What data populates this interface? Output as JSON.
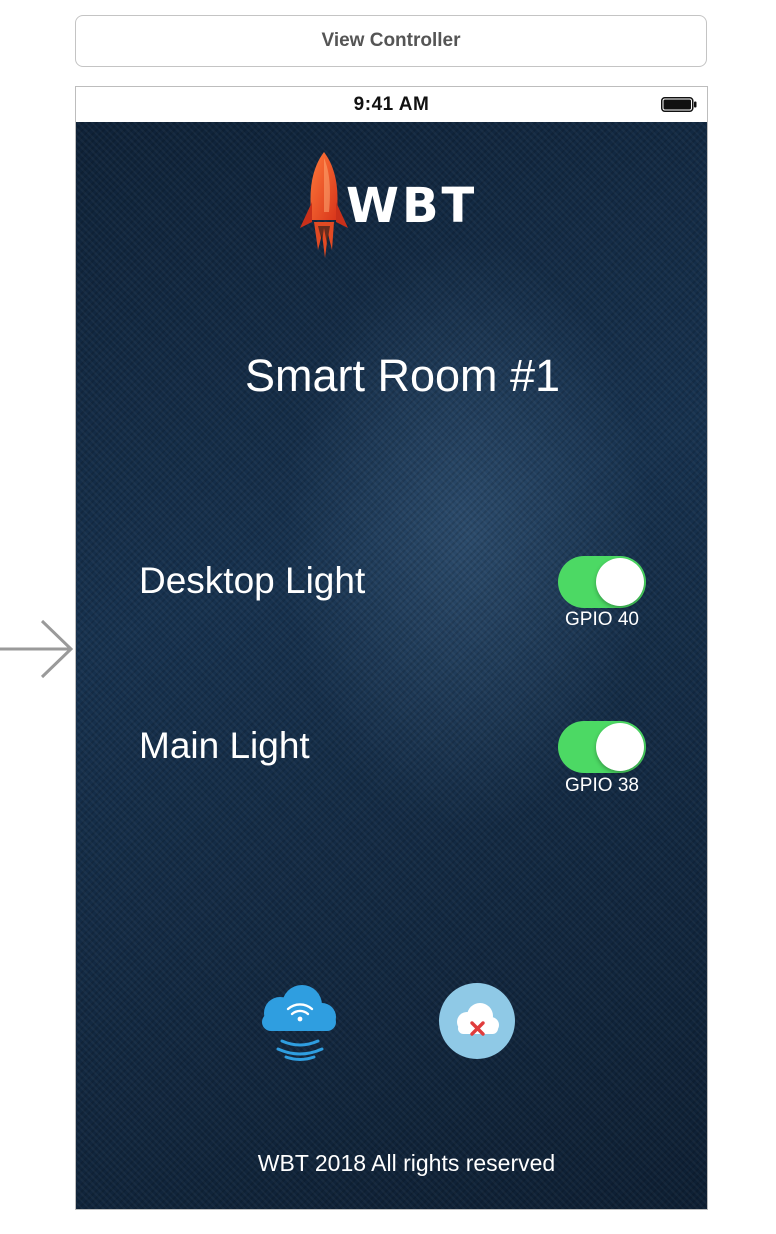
{
  "storyboard": {
    "scene_title": "View Controller"
  },
  "status_bar": {
    "time": "9:41 AM"
  },
  "app": {
    "logo_text": "WBT",
    "room_title": "Smart Room #1",
    "controls": [
      {
        "label": "Desktop Light",
        "gpio": "GPIO 40",
        "on": true
      },
      {
        "label": "Main Light",
        "gpio": "GPIO 38",
        "on": true
      }
    ],
    "footer": "WBT 2018 All rights reserved"
  },
  "icons": {
    "rocket": "rocket-icon",
    "wifi_cloud": "wifi-cloud-icon",
    "cloud_error": "cloud-error-icon",
    "battery": "battery-icon",
    "entry_arrow": "arrow-right-icon"
  },
  "colors": {
    "toggle_on": "#4cd964",
    "background_dark": "#13293f",
    "cloud_blue": "#2f9ee0",
    "error_red": "#e03c3c"
  }
}
